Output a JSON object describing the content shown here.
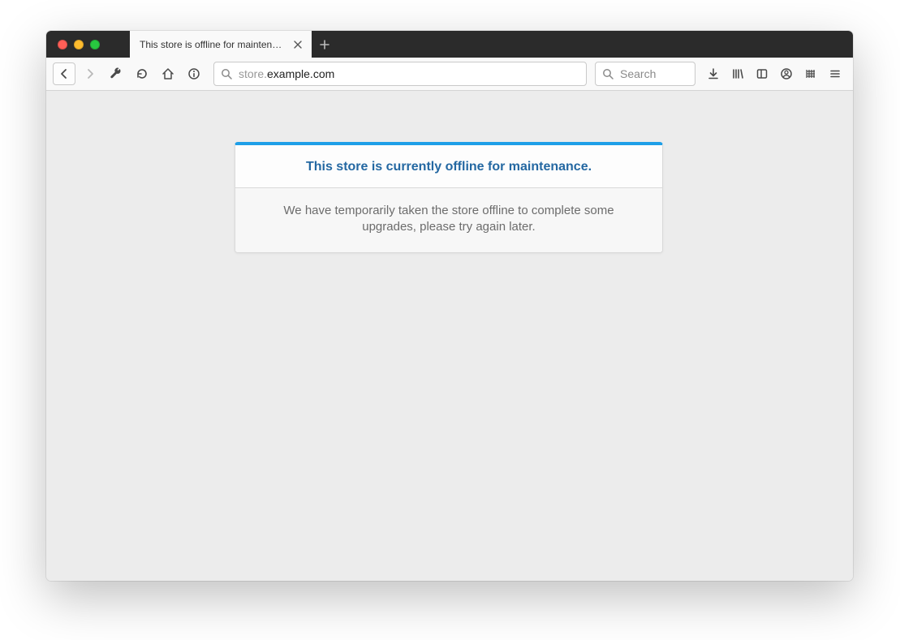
{
  "tab": {
    "title": "This store is offline for maintenance"
  },
  "url": {
    "prefix": "store.",
    "domain": "example.com"
  },
  "search": {
    "placeholder": "Search"
  },
  "card": {
    "heading": "This store is currently offline for maintenance.",
    "body": "We have temporarily taken the store offline to complete some upgrades, please try again later."
  }
}
